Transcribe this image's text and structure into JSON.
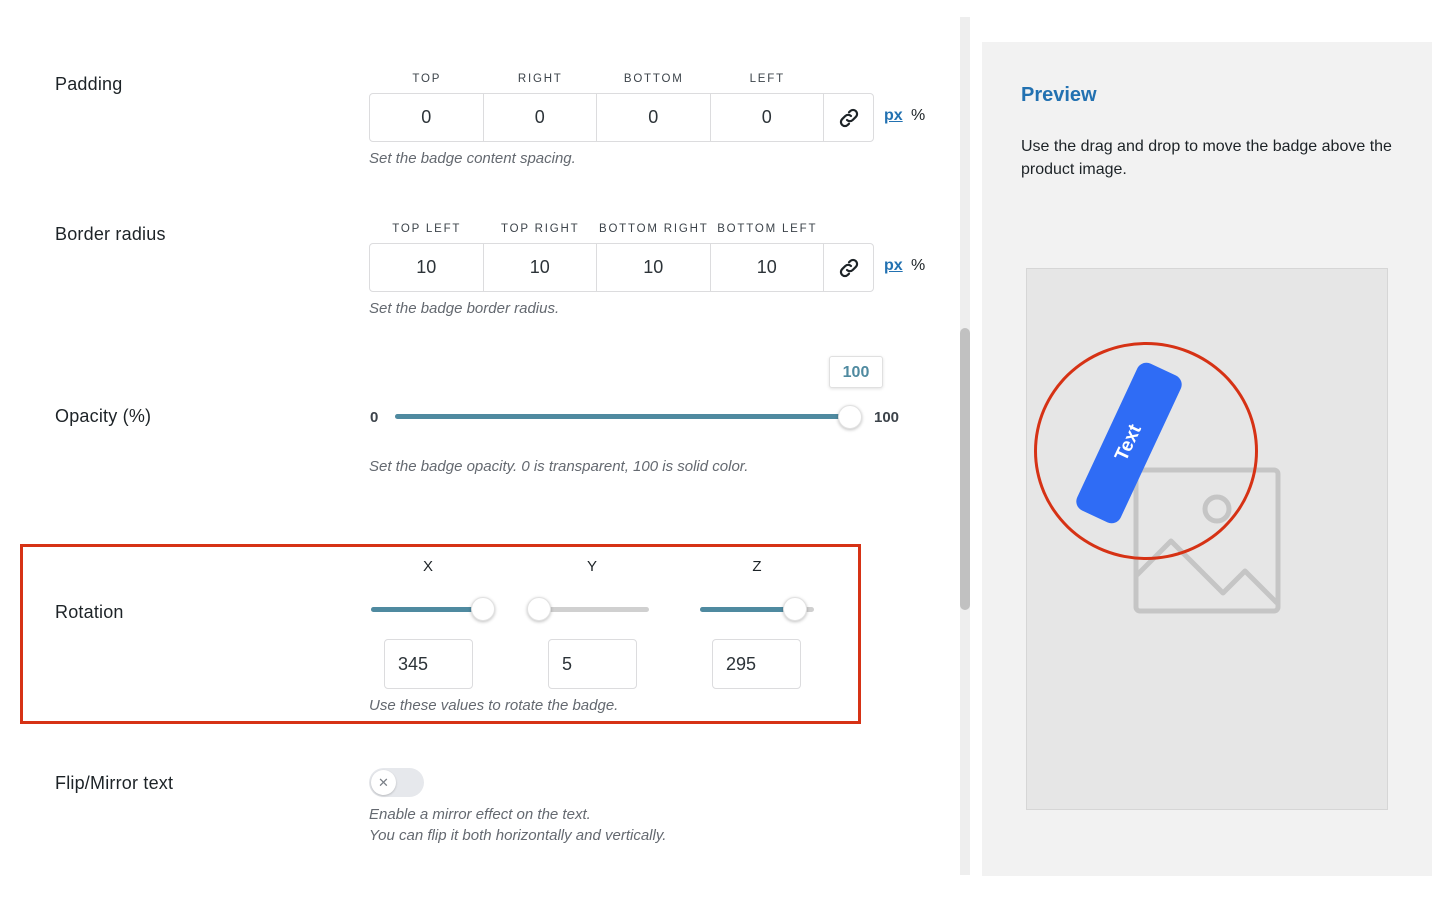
{
  "padding": {
    "label": "Padding",
    "columns": [
      "TOP",
      "RIGHT",
      "BOTTOM",
      "LEFT"
    ],
    "values": [
      "0",
      "0",
      "0",
      "0"
    ],
    "unit_px": "px",
    "unit_pct": "%",
    "help": "Set the badge content spacing."
  },
  "border_radius": {
    "label": "Border radius",
    "columns": [
      "TOP LEFT",
      "TOP RIGHT",
      "BOTTOM RIGHT",
      "BOTTOM LEFT"
    ],
    "values": [
      "10",
      "10",
      "10",
      "10"
    ],
    "unit_px": "px",
    "unit_pct": "%",
    "help": "Set the badge border radius."
  },
  "opacity": {
    "label": "Opacity (%)",
    "min": "0",
    "max": "100",
    "value": "100",
    "help": "Set the badge opacity. 0 is transparent, 100 is solid color."
  },
  "rotation": {
    "label": "Rotation",
    "axes": [
      {
        "name": "X",
        "value": "345",
        "fraction": 0.96
      },
      {
        "name": "Y",
        "value": "5",
        "fraction": 0.01
      },
      {
        "name": "Z",
        "value": "295",
        "fraction": 0.82
      }
    ],
    "help": "Use these values to rotate the badge.",
    "highlight_color": "#d63215"
  },
  "flip": {
    "label": "Flip/Mirror text",
    "enabled": false,
    "help_line1": "Enable a mirror effect on the text.",
    "help_line2": "You can flip it both horizontally and vertically."
  },
  "preview": {
    "title": "Preview",
    "description": "Use the drag and drop to move the badge above the product image.",
    "badge_text": "Text",
    "badge_color": "#2f6cf5",
    "circle_color": "#d63215"
  },
  "colors": {
    "accent": "#2271b1",
    "slider_fill": "#4f8aa0"
  }
}
